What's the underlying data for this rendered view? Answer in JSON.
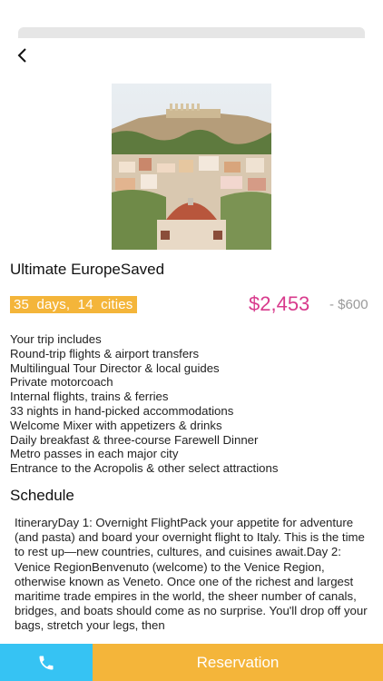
{
  "nav": {
    "back_icon": "chevron-left-icon"
  },
  "hero": {
    "image": "athens-acropolis-photo"
  },
  "tour": {
    "title": "Ultimate EuropeSaved",
    "badge": "35 days, 14 cities",
    "price": "$2,453",
    "discount": "- $600"
  },
  "includes": [
    "Your trip includes",
    "Round-trip flights & airport transfers",
    "Multilingual Tour Director & local guides",
    "Private motorcoach",
    "Internal flights, trains & ferries",
    "33 nights in hand-picked accommodations",
    "Welcome Mixer with appetizers & drinks",
    "Daily breakfast & three-course Farewell Dinner",
    "Metro passes in each major city",
    "Entrance to the Acropolis & other select attractions"
  ],
  "schedule": {
    "heading": "Schedule",
    "text": "ItineraryDay 1: Overnight FlightPack your appetite for adventure (and pasta) and board your overnight flight to Italy. This is the time to rest up—new countries, cultures, and cuisines await.Day 2: Venice RegionBenvenuto (welcome) to the Venice Region, otherwise known as Veneto. Once one of the richest and largest maritime trade empires in the world, the sheer number of canals, bridges, and boats should come as no surprise. You'll drop off your bags, stretch your legs, then"
  },
  "bottom": {
    "call_icon": "phone-icon",
    "reservation_label": "Reservation"
  },
  "colors": {
    "accent_yellow": "#f4b53a",
    "accent_blue": "#36c3f3",
    "price_pink": "#d83a8c"
  }
}
